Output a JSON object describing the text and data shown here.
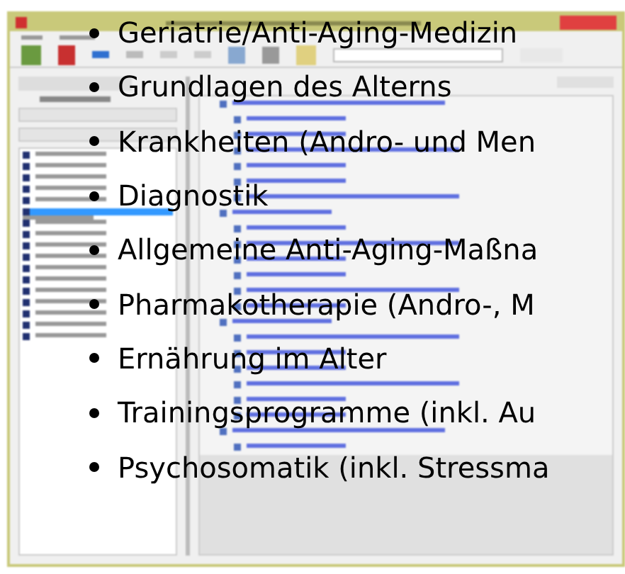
{
  "list": [
    {
      "text": "Geriatrie/Anti-Aging-Medizin"
    },
    {
      "text": "Grundlagen des Alterns"
    },
    {
      "text": "Krankheiten (Andro- und Men"
    },
    {
      "text": "Diagnostik"
    },
    {
      "text": "Allgemeine Anti-Aging-Maßna"
    },
    {
      "text": "Pharmakotherapie (Andro-, M"
    },
    {
      "text": "Ernährung im Alter"
    },
    {
      "text": "Trainingsprogramme (inkl. Au"
    },
    {
      "text": "Psychosomatik (inkl. Stressma"
    }
  ]
}
